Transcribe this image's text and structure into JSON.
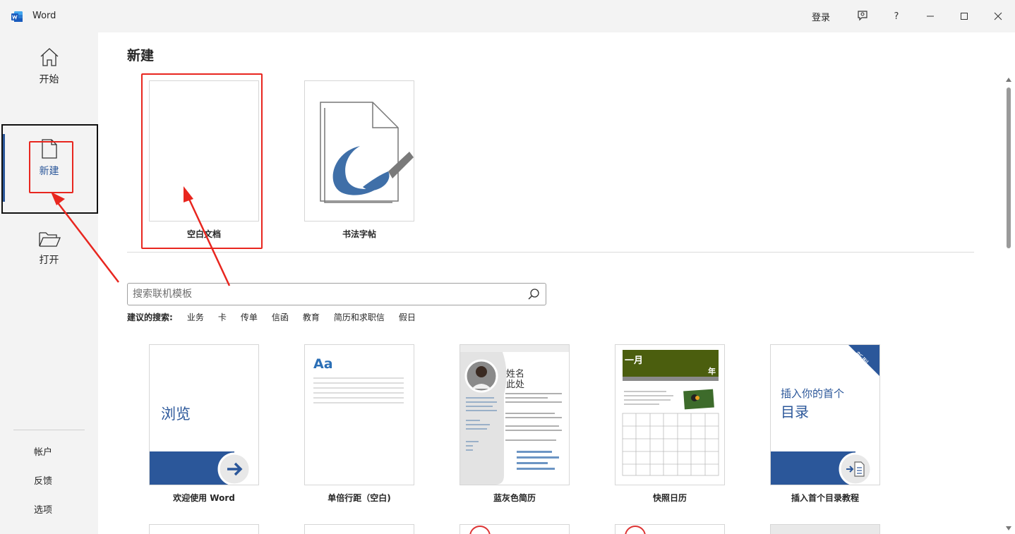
{
  "app": {
    "name": "Word"
  },
  "titlebar": {
    "signin": "登录",
    "help": "?"
  },
  "nav": {
    "home": "开始",
    "new": "新建",
    "open": "打开",
    "account": "帐户",
    "feedback": "反馈",
    "options": "选项"
  },
  "main": {
    "title": "新建",
    "featured": [
      {
        "label": "空白文档"
      },
      {
        "label": "书法字帖"
      }
    ],
    "search": {
      "placeholder": "搜索联机模板"
    },
    "suggested": {
      "label": "建议的搜索:",
      "items": [
        "业务",
        "卡",
        "传单",
        "信函",
        "教育",
        "简历和求职信",
        "假日"
      ]
    },
    "templates": [
      {
        "label": "欢迎使用 Word",
        "thumb_text": "浏览"
      },
      {
        "label": "单倍行距（空白)",
        "thumb_text": "Aa"
      },
      {
        "label": "蓝灰色简历",
        "thumb_name": "姓名",
        "thumb_name2": "此处"
      },
      {
        "label": "快照日历",
        "thumb_month": "一月",
        "thumb_year": "年"
      },
      {
        "label": "插入首个目录教程",
        "thumb_line1": "插入你的首个",
        "thumb_line2": "目录",
        "badge": "新型"
      }
    ]
  },
  "colors": {
    "accent": "#2b579a",
    "annotation": "#e8261f",
    "calendar_header": "#4b5e0e"
  }
}
